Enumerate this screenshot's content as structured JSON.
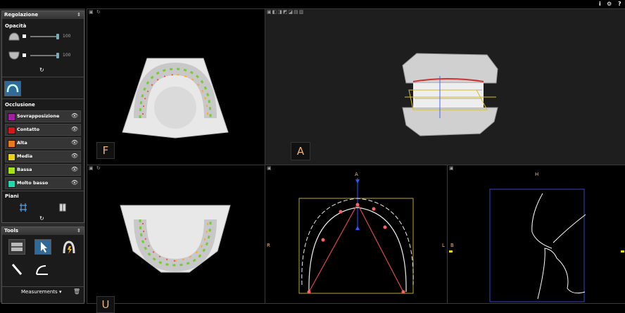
{
  "topbar": {
    "info_icon": "i",
    "settings_icon": "⚙",
    "help_icon": "?"
  },
  "sidebar": {
    "regolazione": {
      "title": "Regolazione",
      "opacity_label": "Opacità",
      "sliders": [
        {
          "value": "100"
        },
        {
          "value": "100"
        }
      ]
    },
    "occlusione": {
      "title": "Occlusione",
      "rows": [
        {
          "label": "Sovrapposizione",
          "color": "#a020a0"
        },
        {
          "label": "Contatto",
          "color": "#d21818"
        },
        {
          "label": "Alta",
          "color": "#e87a1a"
        },
        {
          "label": "Media",
          "color": "#e8d21a"
        },
        {
          "label": "Bassa",
          "color": "#a8e01a"
        },
        {
          "label": "Molto basso",
          "color": "#20d8b0"
        }
      ]
    },
    "piani": {
      "title": "Piani"
    },
    "tools": {
      "title": "Tools",
      "measurements_label": "Measurements"
    }
  },
  "viewports": {
    "F": {
      "label": "F"
    },
    "A": {
      "label": "A"
    },
    "U": {
      "label": "U"
    },
    "axial": {
      "top": "A",
      "left": "R",
      "right": "L"
    },
    "sagittal": {
      "top": "H",
      "left": "B"
    }
  }
}
